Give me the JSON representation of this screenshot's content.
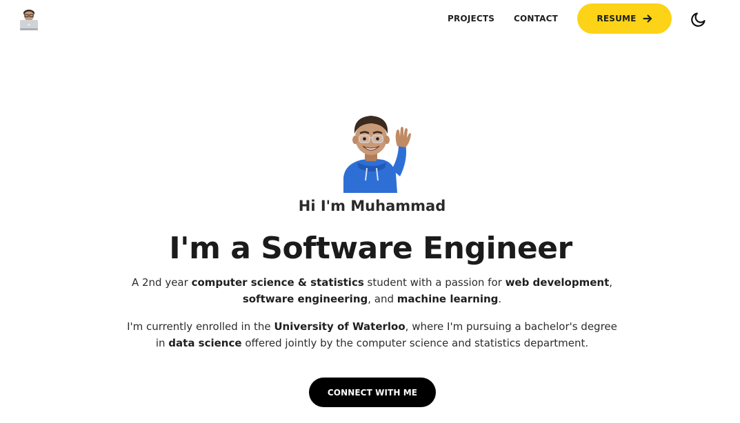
{
  "nav": {
    "logo_icon": "memoji-laptop-icon",
    "projects_label": "PROJECTS",
    "contact_label": "CONTACT",
    "resume_label": "RESUME",
    "resume_icon": "arrow-right-icon",
    "theme_icon": "moon-icon"
  },
  "hero": {
    "avatar_icon": "memoji-waving-icon",
    "greeting": "Hi I'm Muhammad",
    "headline": "I'm a Software Engineer",
    "intro": {
      "line1": {
        "t1": "A 2nd year ",
        "b1": "computer science & statistics",
        "t2": " student with a passion for ",
        "b2": "web development",
        "t3": ","
      },
      "line2": {
        "b1": "software engineering",
        "t1": ", and ",
        "b2": "machine learning",
        "t2": "."
      }
    },
    "education": {
      "line1": {
        "t1": "I'm currently enrolled in the ",
        "b1": "University of Waterloo",
        "t2": ", where I'm pursuing a bachelor's degree"
      },
      "line2": {
        "t1": "in ",
        "b1": "data science",
        "t2": " offered jointly by the computer science and statistics department."
      }
    },
    "cta_label": "CONNECT WITH ME"
  },
  "colors": {
    "accent": "#fcd316",
    "cta_background": "#000000",
    "text": "#222222",
    "background": "#ffffff"
  }
}
